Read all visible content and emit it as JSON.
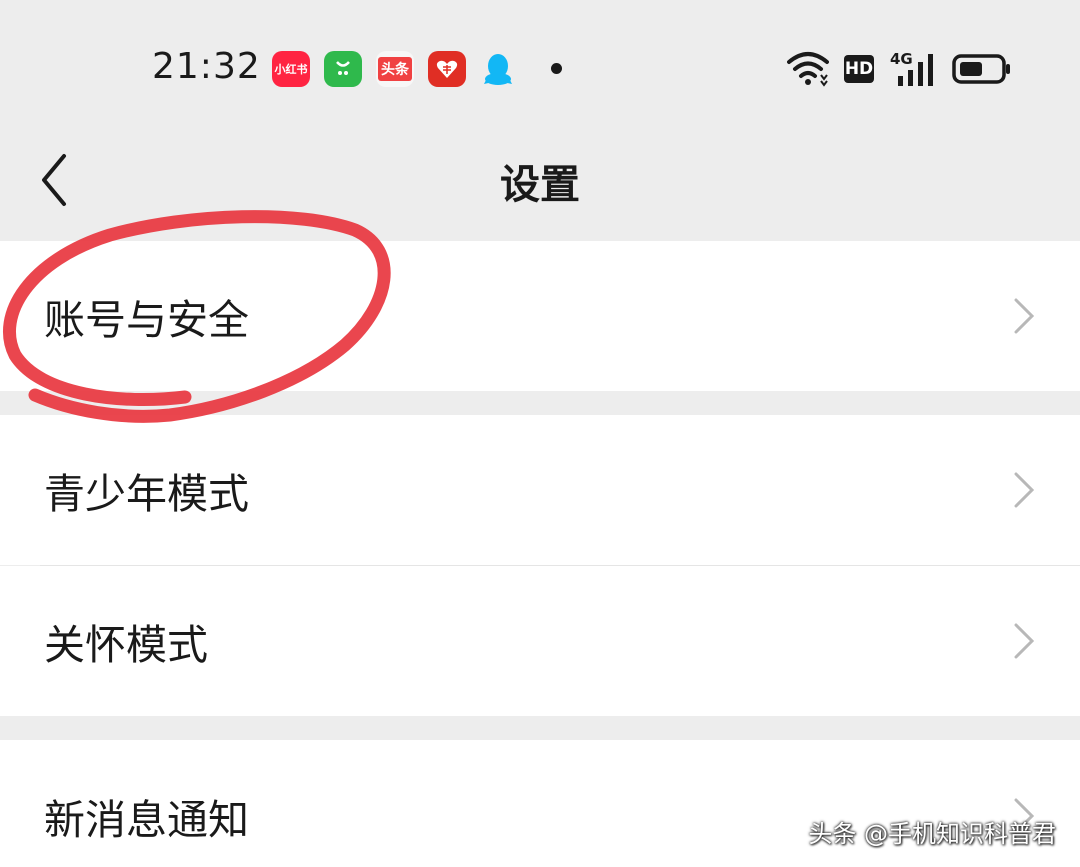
{
  "status_bar": {
    "time": "21:32",
    "apps": [
      {
        "name": "xiaohongshu",
        "label": "小红书",
        "color": "#ff2442"
      },
      {
        "name": "shopping",
        "label": "",
        "color": "#2fb94c"
      },
      {
        "name": "toutiao",
        "label": "头条",
        "color": "#f04142"
      },
      {
        "name": "pinduoduo",
        "label": "",
        "color": "#e02e24"
      },
      {
        "name": "qq",
        "label": "",
        "color": "#12b7f5"
      }
    ],
    "hd_badge": "HD",
    "network": "4G"
  },
  "nav": {
    "title": "设置"
  },
  "settings": {
    "items": [
      {
        "label": "账号与安全"
      },
      {
        "label": "青少年模式"
      },
      {
        "label": "关怀模式"
      },
      {
        "label": "新消息通知"
      }
    ]
  },
  "watermark": "头条 @手机知识科普君",
  "colors": {
    "annotation": "#e8363f",
    "background": "#ededed",
    "row": "#ffffff"
  }
}
